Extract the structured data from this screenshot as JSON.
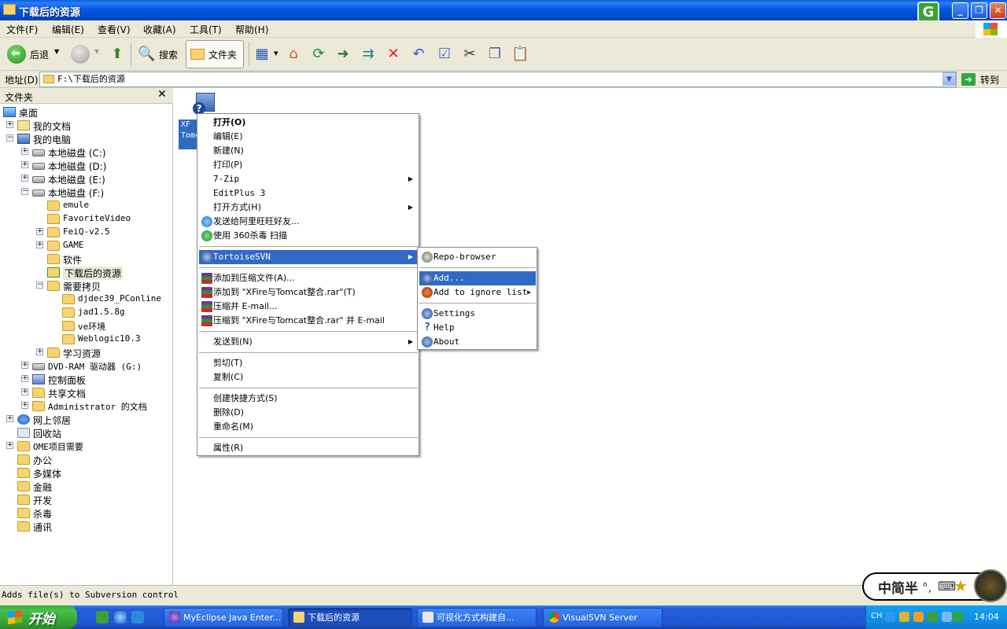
{
  "window": {
    "title": "下载后的资源"
  },
  "menubar": [
    "文件(F)",
    "编辑(E)",
    "查看(V)",
    "收藏(A)",
    "工具(T)",
    "帮助(H)"
  ],
  "toolbar": {
    "back": "后退",
    "search": "搜索",
    "folders": "文件夹"
  },
  "address": {
    "label": "地址(D)",
    "value": "F:\\下载后的资源",
    "go": "转到"
  },
  "folder_pane": {
    "title": "文件夹",
    "tree": [
      {
        "label": "桌面",
        "icon": "desktop-icon",
        "level": 0,
        "expander": ""
      },
      {
        "label": "我的文档",
        "icon": "my-documents-icon",
        "level": 1,
        "expander": "+"
      },
      {
        "label": "我的电脑",
        "icon": "my-computer-icon",
        "level": 1,
        "expander": "-"
      },
      {
        "label": "本地磁盘 (C:)",
        "icon": "drive-icon",
        "level": 2,
        "expander": "+"
      },
      {
        "label": "本地磁盘 (D:)",
        "icon": "drive-icon",
        "level": 2,
        "expander": "+"
      },
      {
        "label": "本地磁盘 (E:)",
        "icon": "drive-icon",
        "level": 2,
        "expander": "+"
      },
      {
        "label": "本地磁盘 (F:)",
        "icon": "drive-icon",
        "level": 2,
        "expander": "-"
      },
      {
        "label": "emule",
        "icon": "folder-icon",
        "level": 3,
        "expander": ""
      },
      {
        "label": "FavoriteVideo",
        "icon": "folder-icon",
        "level": 3,
        "expander": ""
      },
      {
        "label": "FeiQ-v2.5",
        "icon": "folder-icon",
        "level": 3,
        "expander": "+"
      },
      {
        "label": "GAME",
        "icon": "folder-icon",
        "level": 3,
        "expander": "+"
      },
      {
        "label": "软件",
        "icon": "folder-icon",
        "level": 3,
        "expander": ""
      },
      {
        "label": "下载后的资源",
        "icon": "svn-folder-icon",
        "level": 3,
        "expander": "",
        "selected": true
      },
      {
        "label": "需要拷贝",
        "icon": "folder-icon",
        "level": 3,
        "expander": "-"
      },
      {
        "label": "djdec39_PConline",
        "icon": "folder-icon",
        "level": 4,
        "expander": ""
      },
      {
        "label": "jad1.5.8g",
        "icon": "folder-icon",
        "level": 4,
        "expander": ""
      },
      {
        "label": "ve环境",
        "icon": "folder-icon",
        "level": 4,
        "expander": ""
      },
      {
        "label": "Weblogic10.3",
        "icon": "folder-icon",
        "level": 4,
        "expander": ""
      },
      {
        "label": "学习资源",
        "icon": "folder-icon",
        "level": 3,
        "expander": "+"
      },
      {
        "label": "DVD-RAM 驱动器 (G:)",
        "icon": "dvd-drive-icon",
        "level": 2,
        "expander": "+"
      },
      {
        "label": "控制面板",
        "icon": "control-panel-icon",
        "level": 2,
        "expander": "+"
      },
      {
        "label": "共享文档",
        "icon": "folder-icon",
        "level": 2,
        "expander": "+"
      },
      {
        "label": "Administrator 的文档",
        "icon": "folder-icon",
        "level": 2,
        "expander": "+"
      },
      {
        "label": "网上邻居",
        "icon": "network-icon",
        "level": 1,
        "expander": "+"
      },
      {
        "label": "回收站",
        "icon": "recycle-bin-icon",
        "level": 1,
        "expander": ""
      },
      {
        "label": "OME项目需要",
        "icon": "folder-icon",
        "level": 1,
        "expander": "+"
      },
      {
        "label": "办公",
        "icon": "folder-icon",
        "level": 1,
        "expander": ""
      },
      {
        "label": "多媒体",
        "icon": "folder-icon",
        "level": 1,
        "expander": ""
      },
      {
        "label": "金融",
        "icon": "folder-icon",
        "level": 1,
        "expander": ""
      },
      {
        "label": "开发",
        "icon": "folder-icon",
        "level": 1,
        "expander": ""
      },
      {
        "label": "杀毒",
        "icon": "folder-icon",
        "level": 1,
        "expander": ""
      },
      {
        "label": "通讯",
        "icon": "folder-icon",
        "level": 1,
        "expander": ""
      }
    ]
  },
  "file_area": {
    "selected_file_label": "XF Tomc"
  },
  "context_menu": {
    "items": [
      {
        "type": "item",
        "label": "打开(O)",
        "bold": true
      },
      {
        "type": "item",
        "label": "编辑(E)"
      },
      {
        "type": "item",
        "label": "新建(N)"
      },
      {
        "type": "item",
        "label": "打印(P)"
      },
      {
        "type": "item",
        "label": "7-Zip",
        "submenu": true
      },
      {
        "type": "item",
        "label": "EditPlus 3"
      },
      {
        "type": "item",
        "label": "打开方式(H)",
        "submenu": true
      },
      {
        "type": "item",
        "label": "发送给阿里旺旺好友...",
        "icon": "aliwangwang-icon"
      },
      {
        "type": "item",
        "label": "使用 360杀毒 扫描",
        "icon": "shield-360-icon"
      },
      {
        "type": "sep"
      },
      {
        "type": "item",
        "label": "TortoiseSVN",
        "submenu": true,
        "highlight": true,
        "icon": "tortoisesvn-icon"
      },
      {
        "type": "sep"
      },
      {
        "type": "item",
        "label": "添加到压缩文件(A)...",
        "icon": "winrar-icon"
      },
      {
        "type": "item",
        "label": "添加到 \"XFire与Tomcat整合.rar\"(T)",
        "icon": "winrar-icon"
      },
      {
        "type": "item",
        "label": "压缩并 E-mail...",
        "icon": "winrar-icon"
      },
      {
        "type": "item",
        "label": "压缩到 \"XFire与Tomcat整合.rar\" 并 E-mail",
        "icon": "winrar-icon"
      },
      {
        "type": "sep"
      },
      {
        "type": "item",
        "label": "发送到(N)",
        "submenu": true
      },
      {
        "type": "sep"
      },
      {
        "type": "item",
        "label": "剪切(T)"
      },
      {
        "type": "item",
        "label": "复制(C)"
      },
      {
        "type": "sep"
      },
      {
        "type": "item",
        "label": "创建快捷方式(S)"
      },
      {
        "type": "item",
        "label": "删除(D)"
      },
      {
        "type": "item",
        "label": "重命名(M)"
      },
      {
        "type": "sep"
      },
      {
        "type": "item",
        "label": "属性(R)"
      }
    ]
  },
  "svn_submenu": {
    "items": [
      {
        "type": "item",
        "label": "Repo-browser",
        "icon": "repo-browser-icon"
      },
      {
        "type": "sep"
      },
      {
        "type": "item",
        "label": "Add...",
        "highlight": true,
        "icon": "svn-add-icon"
      },
      {
        "type": "item",
        "label": "Add to ignore list",
        "submenu": true,
        "icon": "svn-ignore-icon"
      },
      {
        "type": "sep"
      },
      {
        "type": "item",
        "label": "Settings",
        "icon": "svn-settings-icon"
      },
      {
        "type": "item",
        "label": "Help",
        "icon": "help-icon"
      },
      {
        "type": "item",
        "label": "About",
        "icon": "svn-about-icon"
      }
    ]
  },
  "statusbar": {
    "text": "Adds file(s) to Subversion control"
  },
  "ime": {
    "text": "中简半"
  },
  "taskbar": {
    "start": "开始",
    "tasks": [
      {
        "label": "MyEclipse Java Enter...",
        "icon": "myeclipse-icon",
        "active": false
      },
      {
        "label": "下载后的资源",
        "icon": "folder-icon",
        "active": true
      },
      {
        "label": "可视化方式构建自...",
        "icon": "document-icon",
        "active": false
      },
      {
        "label": "VisualSVN Server",
        "icon": "chrome-icon",
        "active": false
      }
    ],
    "tray_lang": "CH",
    "clock": "14:04"
  },
  "colors": {
    "titlebar": "#0058e6",
    "highlight": "#316ac5",
    "chrome": "#ece9d8",
    "start": "#3aa73a"
  }
}
